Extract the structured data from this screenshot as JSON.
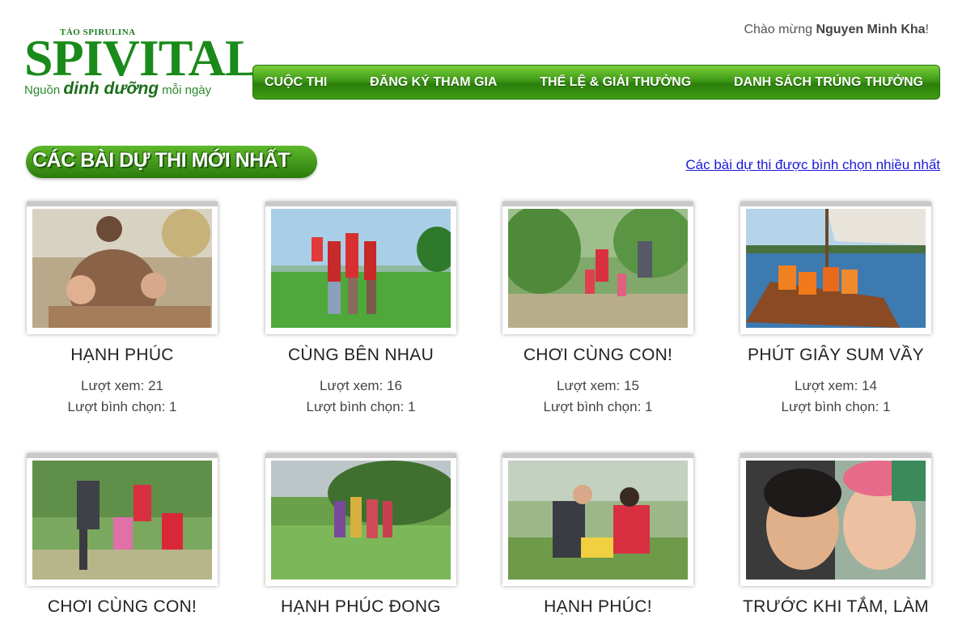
{
  "header": {
    "logo_top": "TẢO SPIRULINA",
    "logo_main": "SPIVITAL",
    "logo_sub_pre": "Nguồn ",
    "logo_sub_emph": "dinh dưỡng",
    "logo_sub_post": " mỗi ngày",
    "welcome_prefix": "Chào mừng ",
    "welcome_user": "Nguyen Minh Kha",
    "welcome_suffix": "!"
  },
  "nav": {
    "items": [
      {
        "label": "CUỘC THI"
      },
      {
        "label": "ĐĂNG KÝ THAM GIA"
      },
      {
        "label": "THỂ LỆ & GIẢI THƯỞNG"
      },
      {
        "label": "DANH SÁCH TRÚNG THƯỞNG"
      }
    ]
  },
  "section": {
    "title": "CÁC BÀI DỰ THI MỚI NHẤT",
    "link": "Các bài dự thi được bình chọn nhiều nhất"
  },
  "entries": [
    {
      "title": "HẠNH PHÚC",
      "views": "Lượt xem: 21",
      "votes": "Lượt bình chọn: 1"
    },
    {
      "title": "CÙNG BÊN NHAU",
      "views": "Lượt xem: 16",
      "votes": "Lượt bình chọn: 1"
    },
    {
      "title": "CHƠI CÙNG CON!",
      "views": "Lượt xem: 15",
      "votes": "Lượt bình chọn: 1"
    },
    {
      "title": "PHÚT GIÂY SUM VẦY",
      "views": "Lượt xem: 14",
      "votes": "Lượt bình chọn: 1"
    },
    {
      "title": "CHƠI CÙNG CON!"
    },
    {
      "title": "HẠNH PHÚC ĐONG"
    },
    {
      "title": "HẠNH PHÚC!"
    },
    {
      "title": "TRƯỚC KHI TẮM, LÀM"
    }
  ],
  "colors": {
    "brand_green": "#1a8a1a",
    "nav_green": "#3e9a16",
    "link_blue": "#1a1ad8"
  }
}
